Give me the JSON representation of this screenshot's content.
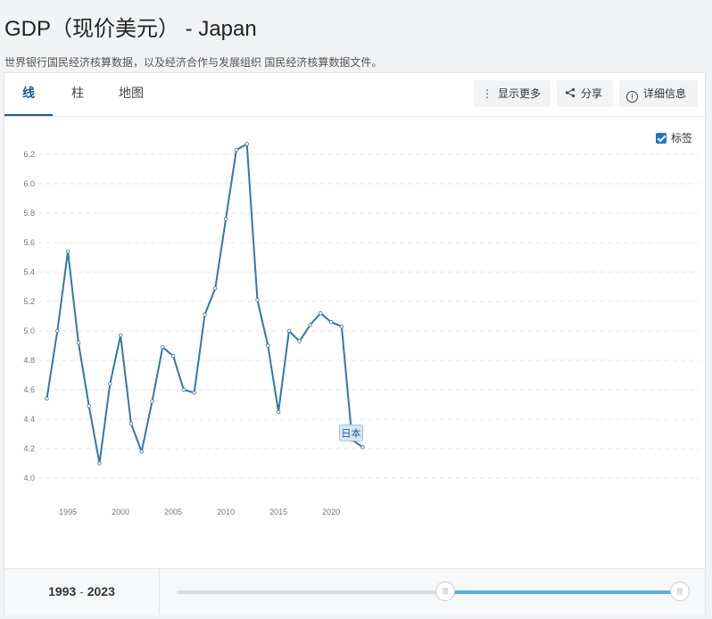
{
  "header": {
    "title": "GDP（现价美元） - Japan",
    "subtitle": "世界银行国民经济核算数据，以及经济合作与发展组织 国民经济核算数据文件。"
  },
  "tabs": [
    {
      "label": "线"
    },
    {
      "label": "柱"
    },
    {
      "label": "地图"
    }
  ],
  "toolbar": {
    "more_label": "显示更多",
    "share_label": "分享",
    "details_label": "详细信息"
  },
  "legend": {
    "label_toggle": "标签",
    "checked": true
  },
  "range": {
    "start": "1993",
    "separator": "-",
    "end": "2023"
  },
  "colors": {
    "line": "#3278a9",
    "accent": "#1a5d96",
    "slider": "#5aaee0"
  },
  "chart_data": {
    "type": "line",
    "x": [
      1993,
      1994,
      1995,
      1996,
      1997,
      1998,
      1999,
      2000,
      2001,
      2002,
      2003,
      2004,
      2005,
      2006,
      2007,
      2008,
      2009,
      2010,
      2011,
      2012,
      2013,
      2014,
      2015,
      2016,
      2017,
      2018,
      2019,
      2020,
      2021,
      2022,
      2023
    ],
    "series": [
      {
        "name": "日本",
        "values": [
          4.54,
          5.0,
          5.54,
          4.92,
          4.49,
          4.1,
          4.64,
          4.97,
          4.37,
          4.18,
          4.52,
          4.89,
          4.83,
          4.6,
          4.58,
          5.11,
          5.29,
          5.76,
          6.23,
          6.27,
          5.21,
          4.9,
          4.45,
          5.0,
          4.93,
          5.04,
          5.12,
          5.06,
          5.03,
          4.26,
          4.21
        ]
      }
    ],
    "ylim": [
      4.0,
      6.2
    ],
    "yticks": [
      "4.0",
      "4.2",
      "4.4",
      "4.6",
      "4.8",
      "5.0",
      "5.2",
      "5.4",
      "5.6",
      "5.8",
      "6.0",
      "6.2"
    ],
    "xticks": [
      "1995",
      "2000",
      "2005",
      "2010",
      "2015",
      "2020"
    ],
    "grid": true
  }
}
